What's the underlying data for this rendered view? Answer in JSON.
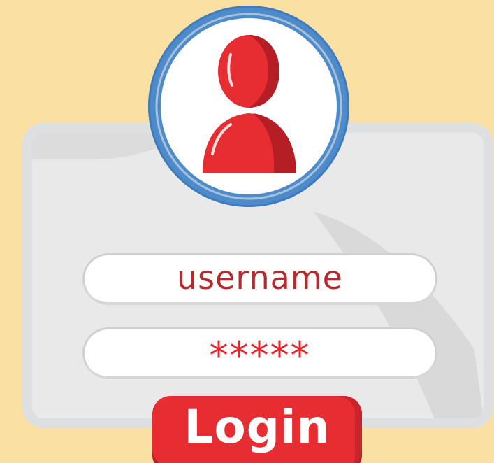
{
  "form": {
    "username_value": "username",
    "password_value": "*****",
    "login_label": "Login"
  },
  "icons": {
    "avatar": "user-avatar-icon"
  },
  "colors": {
    "background": "#fbe0a4",
    "card": "#e9e9ea",
    "ring": "#4d8bcb",
    "accent": "#e52d32",
    "username_text": "#b52a2c"
  }
}
